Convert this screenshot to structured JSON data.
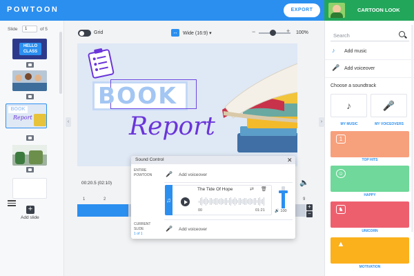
{
  "header": {
    "logo": "POWTOON",
    "export_label": "EXPORT",
    "look_label": "CARTOON LOOK"
  },
  "slides": {
    "label": "Slide",
    "current": "1",
    "total": "of 5",
    "thumbnails": [
      "HELLO CLASS",
      "",
      "BOOK Report",
      "",
      ""
    ],
    "add_slide_label": "Add slide"
  },
  "toolbar": {
    "grid_label": "Grid",
    "ratio_label": "Wide (16:9)",
    "zoom_value": "100%"
  },
  "canvas": {
    "book_text": "BOOK",
    "report_text": "Report"
  },
  "playback": {
    "time": "00:20.5 (02:10)",
    "ticks": [
      "1",
      "2",
      "9"
    ]
  },
  "sound_control": {
    "title": "Sound Control",
    "entire_label_1": "ENTIRE",
    "entire_label_2": "POWTOON",
    "current_label_1": "CURRENT",
    "current_label_2": "SLIDE",
    "current_label_3": "1 of 1",
    "add_voiceover_1": "Add voiceover",
    "add_voiceover_2": "Add voiceover",
    "track_title": "The Tide Of Hope",
    "track_start": "00",
    "track_end": "01:21",
    "volume": "100",
    "volume_level": 0.7
  },
  "sidebar": {
    "search_placeholder": "Search",
    "add_music": "Add music",
    "add_voiceover": "Add voiceover",
    "choose_label": "Choose a soundtrack",
    "tiles": [
      "MY MUSIC",
      "MY VOICEOVERS"
    ],
    "genres": [
      {
        "label": "TOP HITS",
        "color": "#f7a07c"
      },
      {
        "label": "HAPPY",
        "color": "#6fd89a"
      },
      {
        "label": "UNICORN",
        "color": "#ee5f6e"
      },
      {
        "label": "MOTIVATION",
        "color": "#fbb11c"
      }
    ]
  },
  "colors": {
    "accent": "#2b8ff0",
    "look_bar": "#22a65a",
    "report_purple": "#6a35d9"
  }
}
